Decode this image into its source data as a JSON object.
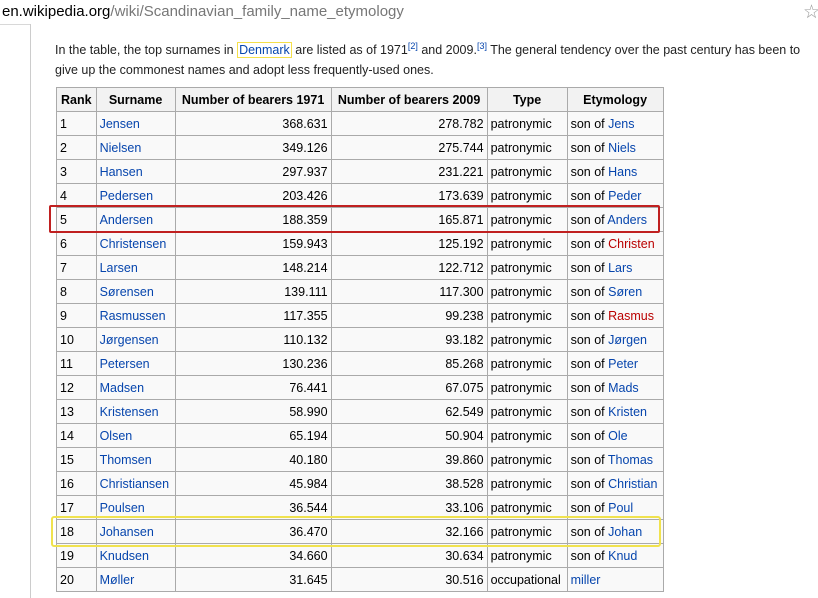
{
  "browser": {
    "domain": "en.wikipedia.org",
    "path": "/wiki/Scandinavian_family_name_etymology"
  },
  "intro": {
    "t1": "In the table, the top surnames in ",
    "country": "Denmark",
    "t2": " are listed as of 1971",
    "ref2": "[2]",
    "t3": " and 2009.",
    "ref3": "[3]",
    "t4": " The general tendency over the past century has been to give up the commonest names and adopt less frequently-used ones."
  },
  "table": {
    "headers": [
      "Rank",
      "Surname",
      "Number of bearers 1971",
      "Number of bearers 2009",
      "Type",
      "Etymology"
    ],
    "rows": [
      {
        "rank": "1",
        "surname": "Jensen",
        "n1971": "368.631",
        "n2009": "278.782",
        "type": "patronymic",
        "etym_prefix": "son of ",
        "etym_name": "Jens"
      },
      {
        "rank": "2",
        "surname": "Nielsen",
        "n1971": "349.126",
        "n2009": "275.744",
        "type": "patronymic",
        "etym_prefix": "son of ",
        "etym_name": "Niels"
      },
      {
        "rank": "3",
        "surname": "Hansen",
        "n1971": "297.937",
        "n2009": "231.221",
        "type": "patronymic",
        "etym_prefix": "son of ",
        "etym_name": "Hans"
      },
      {
        "rank": "4",
        "surname": "Pedersen",
        "n1971": "203.426",
        "n2009": "173.639",
        "type": "patronymic",
        "etym_prefix": "son of ",
        "etym_name": "Peder"
      },
      {
        "rank": "5",
        "surname": "Andersen",
        "n1971": "188.359",
        "n2009": "165.871",
        "type": "patronymic",
        "etym_prefix": "son of ",
        "etym_name": "Anders"
      },
      {
        "rank": "6",
        "surname": "Christensen",
        "n1971": "159.943",
        "n2009": "125.192",
        "type": "patronymic",
        "etym_prefix": "son of ",
        "etym_name": "Christen"
      },
      {
        "rank": "7",
        "surname": "Larsen",
        "n1971": "148.214",
        "n2009": "122.712",
        "type": "patronymic",
        "etym_prefix": "son of ",
        "etym_name": "Lars"
      },
      {
        "rank": "8",
        "surname": "Sørensen",
        "n1971": "139.111",
        "n2009": "117.300",
        "type": "patronymic",
        "etym_prefix": "son of ",
        "etym_name": "Søren"
      },
      {
        "rank": "9",
        "surname": "Rasmussen",
        "n1971": "117.355",
        "n2009": "99.238",
        "type": "patronymic",
        "etym_prefix": "son of ",
        "etym_name": "Rasmus"
      },
      {
        "rank": "10",
        "surname": "Jørgensen",
        "n1971": "110.132",
        "n2009": "93.182",
        "type": "patronymic",
        "etym_prefix": "son of ",
        "etym_name": "Jørgen"
      },
      {
        "rank": "11",
        "surname": "Petersen",
        "n1971": "130.236",
        "n2009": "85.268",
        "type": "patronymic",
        "etym_prefix": "son of ",
        "etym_name": "Peter"
      },
      {
        "rank": "12",
        "surname": "Madsen",
        "n1971": "76.441",
        "n2009": "67.075",
        "type": "patronymic",
        "etym_prefix": "son of ",
        "etym_name": "Mads"
      },
      {
        "rank": "13",
        "surname": "Kristensen",
        "n1971": "58.990",
        "n2009": "62.549",
        "type": "patronymic",
        "etym_prefix": "son of ",
        "etym_name": "Kristen"
      },
      {
        "rank": "14",
        "surname": "Olsen",
        "n1971": "65.194",
        "n2009": "50.904",
        "type": "patronymic",
        "etym_prefix": "son of ",
        "etym_name": "Ole"
      },
      {
        "rank": "15",
        "surname": "Thomsen",
        "n1971": "40.180",
        "n2009": "39.860",
        "type": "patronymic",
        "etym_prefix": "son of ",
        "etym_name": "Thomas"
      },
      {
        "rank": "16",
        "surname": "Christiansen",
        "n1971": "45.984",
        "n2009": "38.528",
        "type": "patronymic",
        "etym_prefix": "son of ",
        "etym_name": "Christian"
      },
      {
        "rank": "17",
        "surname": "Poulsen",
        "n1971": "36.544",
        "n2009": "33.106",
        "type": "patronymic",
        "etym_prefix": "son of ",
        "etym_name": "Poul"
      },
      {
        "rank": "18",
        "surname": "Johansen",
        "n1971": "36.470",
        "n2009": "32.166",
        "type": "patronymic",
        "etym_prefix": "son of ",
        "etym_name": "Johan"
      },
      {
        "rank": "19",
        "surname": "Knudsen",
        "n1971": "34.660",
        "n2009": "30.634",
        "type": "patronymic",
        "etym_prefix": "son of ",
        "etym_name": "Knud"
      },
      {
        "rank": "20",
        "surname": "Møller",
        "n1971": "31.645",
        "n2009": "30.516",
        "type": "occupational",
        "etym_prefix": "",
        "etym_name": "miller"
      }
    ]
  },
  "colors": {
    "link": "#0645ad",
    "redlink": "#ba0000",
    "highlight_red": "#c02020",
    "highlight_yellow": "#f0e24e"
  }
}
